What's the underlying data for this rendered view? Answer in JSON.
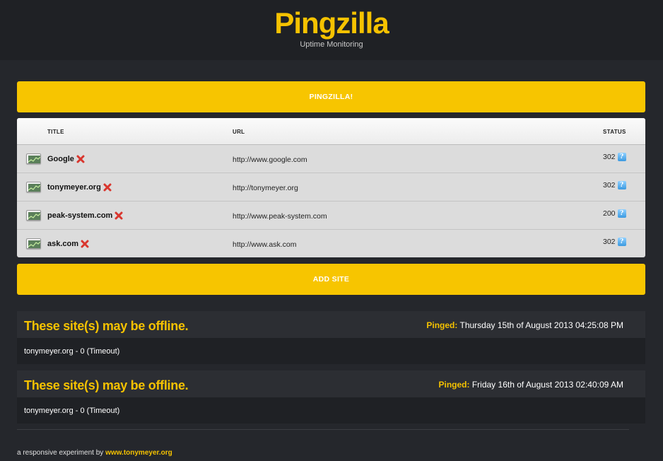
{
  "header": {
    "logo": "Pingzilla",
    "tagline": "Uptime Monitoring"
  },
  "ping_button_label": "PINGZILLA!",
  "sites_table": {
    "columns": [
      "TITLE",
      "URL",
      "STATUS"
    ],
    "rows": [
      {
        "title": "Google",
        "url": "http://www.google.com",
        "status": "302"
      },
      {
        "title": "tonymeyer.org",
        "url": "http://tonymeyer.org",
        "status": "302"
      },
      {
        "title": "peak-system.com",
        "url": "http://www.peak-system.com",
        "status": "200"
      },
      {
        "title": "ask.com",
        "url": "http://www.ask.com",
        "status": "302"
      }
    ],
    "info_glyph": "?"
  },
  "add_site_label": "ADD SITE",
  "alerts": [
    {
      "title": "These site(s) may be offline.",
      "pinged_label": "Pinged:",
      "pinged_time": "Thursday 15th of August 2013 04:25:08 PM",
      "message": "tonymeyer.org - 0 (Timeout)"
    },
    {
      "title": "These site(s) may be offline.",
      "pinged_label": "Pinged:",
      "pinged_time": "Friday 16th of August 2013 02:40:09 AM",
      "message": "tonymeyer.org - 0 (Timeout)"
    }
  ],
  "footer": {
    "text": "a responsive experiment by",
    "link": "www.tonymeyer.org"
  },
  "colors": {
    "accent": "#f7c500",
    "background": "#25272c",
    "table_bg": "#dcdcdc",
    "delete_red": "#d9362e",
    "info_blue": "#3b9ae0"
  },
  "icons": {
    "row_thumbnail": "chart-thumbnail-icon",
    "delete": "delete-icon",
    "status_info": "info-icon"
  }
}
